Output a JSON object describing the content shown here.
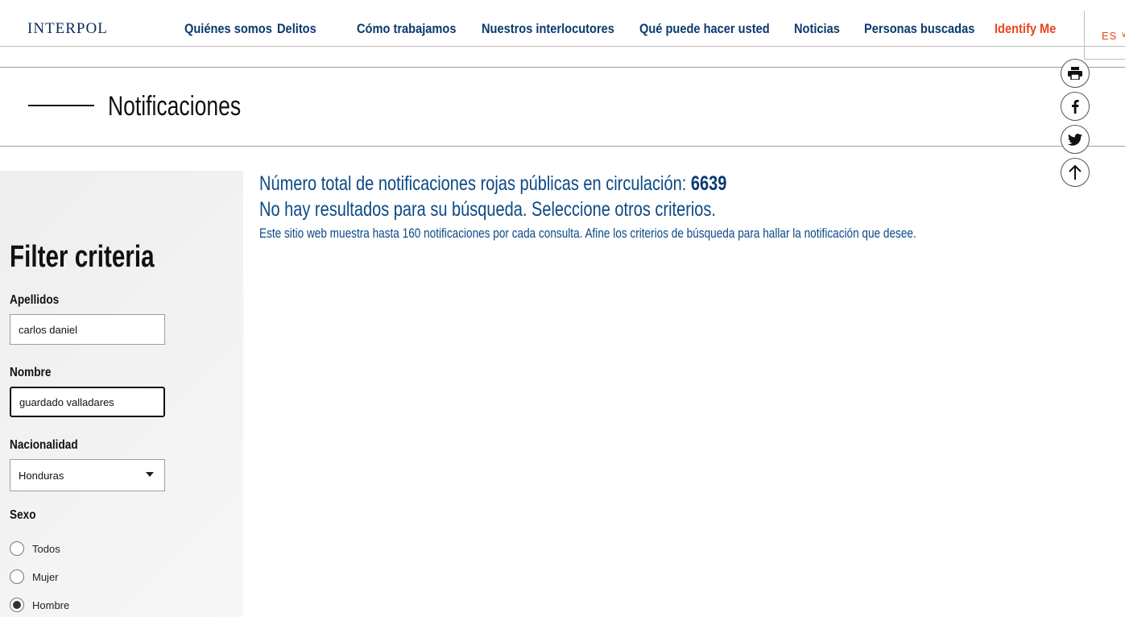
{
  "header": {
    "logo": "INTERPOL",
    "nav": [
      {
        "label": "Quiénes somos"
      },
      {
        "label": "Delitos"
      },
      {
        "label": "Cómo trabajamos"
      },
      {
        "label": "Nuestros interlocutores"
      },
      {
        "label": "Qué puede hacer usted"
      },
      {
        "label": "Noticias"
      },
      {
        "label": "Personas buscadas"
      },
      {
        "label": "Identify Me"
      }
    ],
    "language": "ES",
    "accent_color": "#e8451e",
    "nav_color": "#0b3a6e"
  },
  "page": {
    "title": "Notificaciones"
  },
  "share": {
    "icons": [
      "print-icon",
      "facebook-icon",
      "twitter-icon",
      "arrow-up-icon"
    ]
  },
  "sidebar": {
    "title": "Filter criteria",
    "surname_label": "Apellidos",
    "surname_value": "carlos daniel",
    "name_label": "Nombre",
    "name_value": "guardado valladares",
    "nationality_label": "Nacionalidad",
    "nationality_value": "Honduras",
    "sex_label": "Sexo",
    "sex_options": [
      {
        "label": "Todos",
        "checked": false
      },
      {
        "label": "Mujer",
        "checked": false
      },
      {
        "label": "Hombre",
        "checked": true
      }
    ]
  },
  "results": {
    "total_prefix": "Número total de notificaciones rojas públicas en circulación:",
    "total_count": "6639",
    "no_results": "No hay resultados para su búsqueda. Seleccione otros criterios.",
    "note": "Este sitio web muestra hasta 160 notificaciones por cada consulta. Afine los criterios de búsqueda para hallar la notificación que desee."
  }
}
